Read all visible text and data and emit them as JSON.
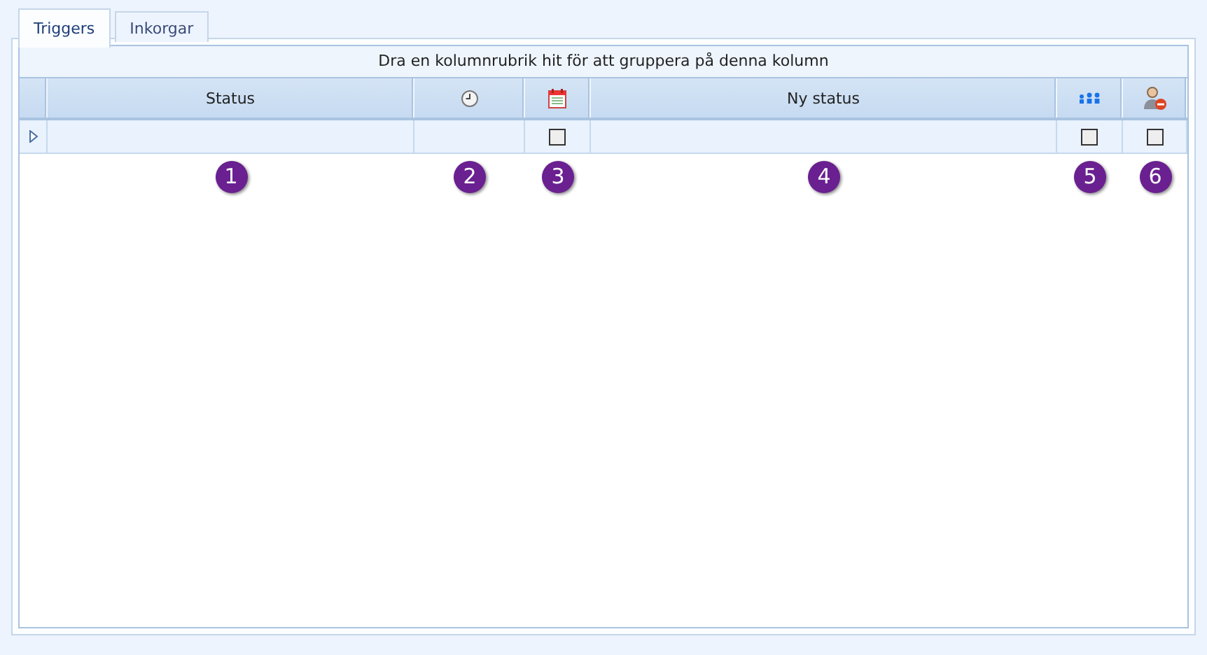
{
  "tabs": [
    {
      "label": "Triggers",
      "selected": true
    },
    {
      "label": "Inkorgar",
      "selected": false
    }
  ],
  "group_panel": {
    "text": "Dra en kolumnrubrik hit för att gruppera på denna kolumn"
  },
  "columns": [
    {
      "kind": "text",
      "label": "Status"
    },
    {
      "kind": "clock"
    },
    {
      "kind": "calendar"
    },
    {
      "kind": "text",
      "label": "Ny status"
    },
    {
      "kind": "people"
    },
    {
      "kind": "user"
    }
  ],
  "new_row": {
    "cells": [
      {
        "kind": "empty"
      },
      {
        "kind": "empty"
      },
      {
        "kind": "checkbox",
        "checked": false
      },
      {
        "kind": "empty"
      },
      {
        "kind": "checkbox",
        "checked": false
      },
      {
        "kind": "checkbox",
        "checked": false
      }
    ]
  },
  "callouts": [
    "1",
    "2",
    "3",
    "4",
    "5",
    "6"
  ]
}
